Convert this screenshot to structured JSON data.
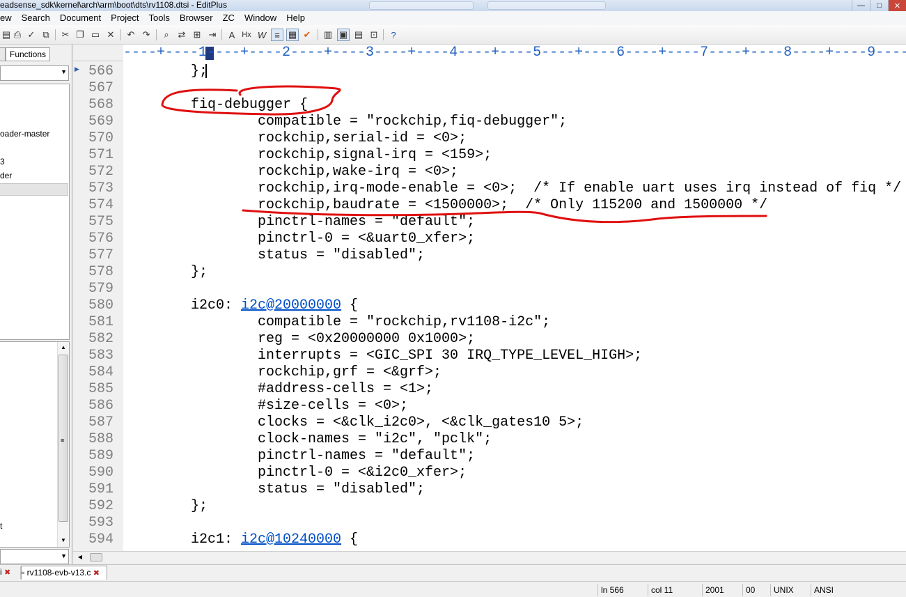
{
  "window": {
    "title": "eadsense_sdk\\kernel\\arch\\arm\\boot\\dts\\rv1108.dtsi - EditPlus",
    "controls": [
      "—",
      "□",
      "✕"
    ]
  },
  "menu": {
    "items": [
      "ew",
      "Search",
      "Document",
      "Project",
      "Tools",
      "Browser",
      "ZC",
      "Window",
      "Help"
    ]
  },
  "toolbar": {
    "icons": [
      {
        "name": "save-all-icon",
        "glyph": "▤"
      },
      {
        "name": "print-icon",
        "glyph": "⎙"
      },
      {
        "name": "spellcheck-icon",
        "glyph": "✓"
      },
      {
        "name": "print-preview-icon",
        "glyph": "⧉"
      },
      {
        "name": "cut-icon",
        "glyph": "✂"
      },
      {
        "name": "copy-icon",
        "glyph": "❐"
      },
      {
        "name": "paste-icon",
        "glyph": "▭"
      },
      {
        "name": "delete-icon",
        "glyph": "✕"
      },
      {
        "name": "undo-icon",
        "glyph": "↶"
      },
      {
        "name": "redo-icon",
        "glyph": "↷"
      },
      {
        "name": "find-icon",
        "glyph": "⌕"
      },
      {
        "name": "replace-icon",
        "glyph": "⇄"
      },
      {
        "name": "find-in-files-icon",
        "glyph": "⊞"
      },
      {
        "name": "goto-icon",
        "glyph": "⇥"
      },
      {
        "name": "font-icon",
        "glyph": "A"
      },
      {
        "name": "hex-icon",
        "glyph": "Hx"
      },
      {
        "name": "word-wrap-icon",
        "glyph": "W"
      },
      {
        "name": "line-number-icon",
        "glyph": "≡"
      },
      {
        "name": "ruler-icon",
        "glyph": "▦"
      },
      {
        "name": "check-icon",
        "glyph": "✔"
      },
      {
        "name": "window-list-icon",
        "glyph": "▥"
      },
      {
        "name": "directory-window-icon",
        "glyph": "▣"
      },
      {
        "name": "cliptext-icon",
        "glyph": "▤"
      },
      {
        "name": "output-window-icon",
        "glyph": "⊡"
      },
      {
        "name": "help-icon",
        "glyph": "?"
      }
    ]
  },
  "left_panel": {
    "functions_tab": "Functions",
    "folders": [
      "oader-master",
      "3",
      "der"
    ],
    "file_list_marker": "t"
  },
  "ruler": {
    "text": "----+----1----+----2----+----3----+----4----+----5----+----6----+----7----+----8----+----9----"
  },
  "editor": {
    "lines": [
      {
        "num": "566",
        "text": "};"
      },
      {
        "num": "567",
        "text": ""
      },
      {
        "num": "568",
        "text": "fiq-debugger {"
      },
      {
        "num": "569",
        "text": "        compatible = \"rockchip,fiq-debugger\";"
      },
      {
        "num": "570",
        "text": "        rockchip,serial-id = <0>;"
      },
      {
        "num": "571",
        "text": "        rockchip,signal-irq = <159>;"
      },
      {
        "num": "572",
        "text": "        rockchip,wake-irq = <0>;"
      },
      {
        "num": "573",
        "text": "        rockchip,irq-mode-enable = <0>;  /* If enable uart uses irq instead of fiq */"
      },
      {
        "num": "574",
        "text": "        rockchip,baudrate = <1500000>;  /* Only 115200 and 1500000 */"
      },
      {
        "num": "575",
        "text": "        pinctrl-names = \"default\";"
      },
      {
        "num": "576",
        "text": "        pinctrl-0 = <&uart0_xfer>;"
      },
      {
        "num": "577",
        "text": "        status = \"disabled\";"
      },
      {
        "num": "578",
        "text": "};"
      },
      {
        "num": "579",
        "text": ""
      },
      {
        "num": "580",
        "pre": "i2c0: ",
        "link": "i2c@20000000",
        "post": " {"
      },
      {
        "num": "581",
        "text": "        compatible = \"rockchip,rv1108-i2c\";"
      },
      {
        "num": "582",
        "text": "        reg = <0x20000000 0x1000>;"
      },
      {
        "num": "583",
        "text": "        interrupts = <GIC_SPI 30 IRQ_TYPE_LEVEL_HIGH>;"
      },
      {
        "num": "584",
        "text": "        rockchip,grf = <&grf>;"
      },
      {
        "num": "585",
        "text": "        #address-cells = <1>;"
      },
      {
        "num": "586",
        "text": "        #size-cells = <0>;"
      },
      {
        "num": "587",
        "text": "        clocks = <&clk_i2c0>, <&clk_gates10 5>;"
      },
      {
        "num": "588",
        "text": "        clock-names = \"i2c\", \"pclk\";"
      },
      {
        "num": "589",
        "text": "        pinctrl-names = \"default\";"
      },
      {
        "num": "590",
        "text": "        pinctrl-0 = <&i2c0_xfer>;"
      },
      {
        "num": "591",
        "text": "        status = \"disabled\";"
      },
      {
        "num": "592",
        "text": "};"
      },
      {
        "num": "593",
        "text": ""
      },
      {
        "num": "594",
        "pre": "i2c1: ",
        "link": "i2c@10240000",
        "post": " {"
      }
    ],
    "link_color": "#0050c8",
    "annotation_color": "#e01010"
  },
  "doc_tabs": {
    "partial": "i",
    "active": "rv1108-evb-v13.c"
  },
  "status_bar": {
    "line": "ln 566",
    "col": "col 11",
    "lines_total": "2001",
    "code": "00",
    "eol": "UNIX",
    "encoding": "ANSI"
  }
}
